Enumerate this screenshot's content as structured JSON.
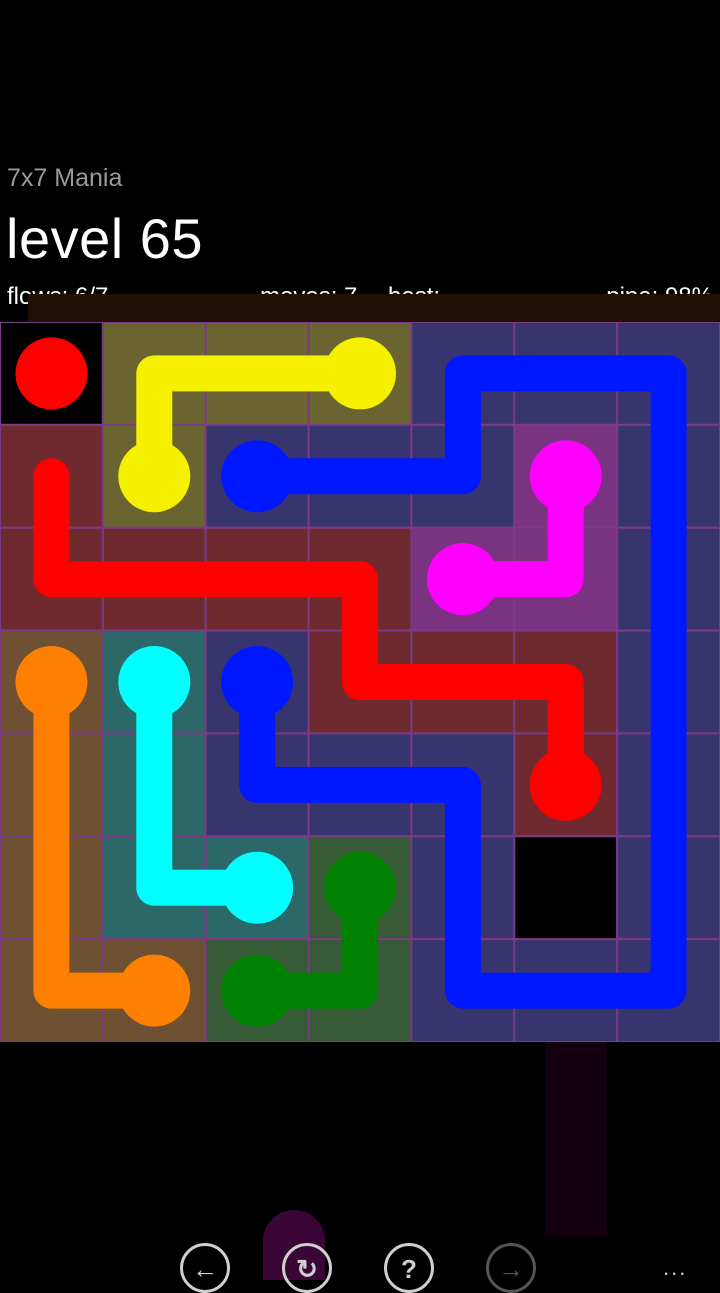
{
  "header": {
    "pack_title": "7x7 Mania",
    "level_title": "level 65",
    "flows": "flows: 6/7",
    "moves": "moves: 7",
    "best": "best: -",
    "pipe": "pipe: 98%"
  },
  "board": {
    "size": 7,
    "grid_line_color": "#7a3a86",
    "flows": [
      {
        "name": "red",
        "color": "#ff0000",
        "tint": "#6e2a2f",
        "endpoints": [
          [
            0,
            0
          ],
          [
            4,
            5
          ]
        ],
        "path": [
          [
            1,
            0
          ],
          [
            2,
            0
          ],
          [
            2,
            1
          ],
          [
            2,
            2
          ],
          [
            2,
            3
          ],
          [
            3,
            3
          ],
          [
            3,
            4
          ],
          [
            3,
            5
          ],
          [
            4,
            5
          ]
        ],
        "complete": false
      },
      {
        "name": "yellow",
        "color": "#f5f000",
        "tint": "#6a6530",
        "endpoints": [
          [
            1,
            1
          ],
          [
            0,
            3
          ]
        ],
        "path": [
          [
            1,
            1
          ],
          [
            0,
            1
          ],
          [
            0,
            2
          ],
          [
            0,
            3
          ]
        ],
        "complete": true
      },
      {
        "name": "blue",
        "color": "#0018ff",
        "tint": "#38356e",
        "endpoints": [
          [
            1,
            2
          ],
          [
            3,
            2
          ]
        ],
        "path": [
          [
            1,
            2
          ],
          [
            1,
            3
          ],
          [
            1,
            4
          ],
          [
            0,
            4
          ],
          [
            0,
            5
          ],
          [
            0,
            6
          ],
          [
            1,
            6
          ],
          [
            2,
            6
          ],
          [
            3,
            6
          ],
          [
            4,
            6
          ],
          [
            5,
            6
          ],
          [
            6,
            6
          ],
          [
            6,
            5
          ],
          [
            6,
            4
          ],
          [
            5,
            4
          ],
          [
            4,
            4
          ],
          [
            4,
            3
          ],
          [
            4,
            2
          ],
          [
            3,
            2
          ]
        ],
        "complete": true
      },
      {
        "name": "magenta",
        "color": "#ff00ff",
        "tint": "#7a3380",
        "endpoints": [
          [
            1,
            5
          ],
          [
            2,
            4
          ]
        ],
        "path": [
          [
            1,
            5
          ],
          [
            2,
            5
          ],
          [
            2,
            4
          ]
        ],
        "complete": true
      },
      {
        "name": "orange",
        "color": "#ff7f00",
        "tint": "#6e5032",
        "endpoints": [
          [
            3,
            0
          ],
          [
            6,
            1
          ]
        ],
        "path": [
          [
            3,
            0
          ],
          [
            4,
            0
          ],
          [
            5,
            0
          ],
          [
            6,
            0
          ],
          [
            6,
            1
          ]
        ],
        "complete": true
      },
      {
        "name": "cyan",
        "color": "#00ffff",
        "tint": "#2c6868",
        "endpoints": [
          [
            3,
            1
          ],
          [
            5,
            2
          ]
        ],
        "path": [
          [
            3,
            1
          ],
          [
            4,
            1
          ],
          [
            5,
            1
          ],
          [
            5,
            2
          ]
        ],
        "complete": true
      },
      {
        "name": "green",
        "color": "#008000",
        "tint": "#355a35",
        "endpoints": [
          [
            5,
            3
          ],
          [
            6,
            2
          ]
        ],
        "path": [
          [
            5,
            3
          ],
          [
            6,
            3
          ],
          [
            6,
            2
          ]
        ],
        "complete": true
      }
    ]
  },
  "controls": {
    "back_icon": "arrow-left-icon",
    "restart_icon": "refresh-icon",
    "hint_icon": "question-icon",
    "next_icon": "arrow-right-icon",
    "back_glyph": "←",
    "restart_glyph": "↻",
    "hint_glyph": "?",
    "next_glyph": "→",
    "more": "..."
  }
}
